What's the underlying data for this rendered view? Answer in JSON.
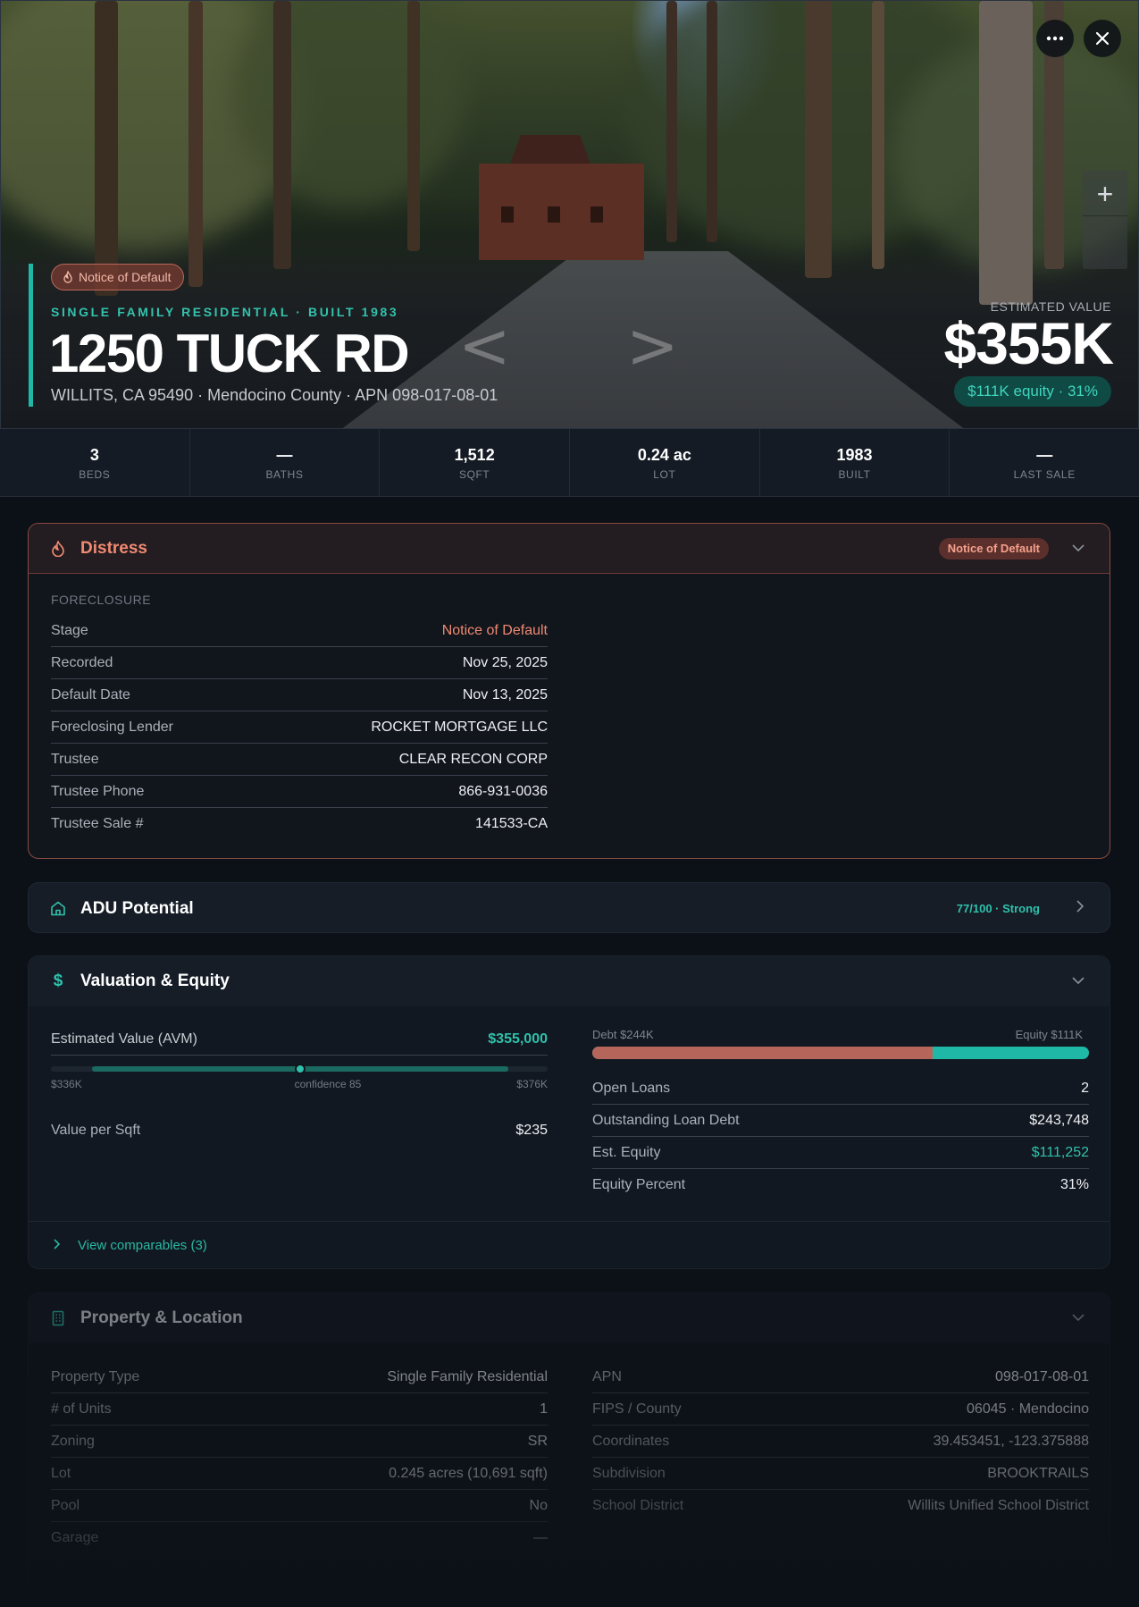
{
  "hero": {
    "badge": "Notice of Default",
    "subtitle": "SINGLE FAMILY RESIDENTIAL · BUILT 1983",
    "title": "1250 TUCK RD",
    "address": "WILLITS, CA 95490 · Mendocino County · APN 098-017-08-01",
    "est_label": "ESTIMATED VALUE",
    "est_value": "$355K",
    "equity_pill": "$111K equity · 31%"
  },
  "stats": [
    {
      "value": "3",
      "label": "BEDS"
    },
    {
      "value": "—",
      "label": "BATHS"
    },
    {
      "value": "1,512",
      "label": "SQFT"
    },
    {
      "value": "0.24 ac",
      "label": "LOT"
    },
    {
      "value": "1983",
      "label": "BUILT"
    },
    {
      "value": "—",
      "label": "LAST SALE"
    }
  ],
  "distress": {
    "title": "Distress",
    "badge": "Notice of Default",
    "section": "FORECLOSURE",
    "rows": [
      {
        "k": "Stage",
        "v": "Notice of Default"
      },
      {
        "k": "Recorded",
        "v": "Nov 25, 2025"
      },
      {
        "k": "Default Date",
        "v": "Nov 13, 2025"
      },
      {
        "k": "Foreclosing Lender",
        "v": "ROCKET MORTGAGE LLC"
      },
      {
        "k": "Trustee",
        "v": "CLEAR RECON CORP"
      },
      {
        "k": "Trustee Phone",
        "v": "866-931-0036"
      },
      {
        "k": "Trustee Sale #",
        "v": "141533-CA"
      }
    ]
  },
  "adu": {
    "title": "ADU Potential",
    "score": "77/100 · Strong"
  },
  "valuation": {
    "title": "Valuation & Equity",
    "avm_label": "Estimated Value (AVM)",
    "avm_value": "$355,000",
    "range_low": "$336K",
    "range_high": "$376K",
    "confidence": "confidence 85",
    "confidence_fraction": 0.5,
    "vps_label": "Value per Sqft",
    "vps_value": "$235",
    "debt_label": "Debt $244K",
    "equity_label": "Equity $111K",
    "debt_fraction": 0.686,
    "rows": [
      {
        "k": "Open Loans",
        "v": "2"
      },
      {
        "k": "Outstanding Loan Debt",
        "v": "$243,748"
      },
      {
        "k": "Est. Equity",
        "v": "$111,252"
      },
      {
        "k": "Equity Percent",
        "v": "31%"
      }
    ],
    "comparables": "View comparables (3)"
  },
  "property": {
    "title": "Property & Location",
    "left_rows": [
      {
        "k": "Property Type",
        "v": "Single Family Residential"
      },
      {
        "k": "# of Units",
        "v": "1"
      },
      {
        "k": "Zoning",
        "v": "SR"
      },
      {
        "k": "Lot",
        "v": "0.245 acres (10,691 sqft)"
      },
      {
        "k": "Pool",
        "v": "No"
      },
      {
        "k": "Garage",
        "v": "—"
      }
    ],
    "right_rows": [
      {
        "k": "APN",
        "v": "098-017-08-01"
      },
      {
        "k": "FIPS / County",
        "v": "06045 · Mendocino"
      },
      {
        "k": "Coordinates",
        "v": "39.453451, -123.375888"
      },
      {
        "k": "Subdivision",
        "v": "BROOKTRAILS"
      },
      {
        "k": "School District",
        "v": "Willits Unified School District"
      }
    ]
  },
  "colors": {
    "accent": "#1fb8a6",
    "distress": "#f08a72",
    "debt": "#b5655a",
    "equity": "#1fb8a6",
    "background": "#0c1118"
  }
}
